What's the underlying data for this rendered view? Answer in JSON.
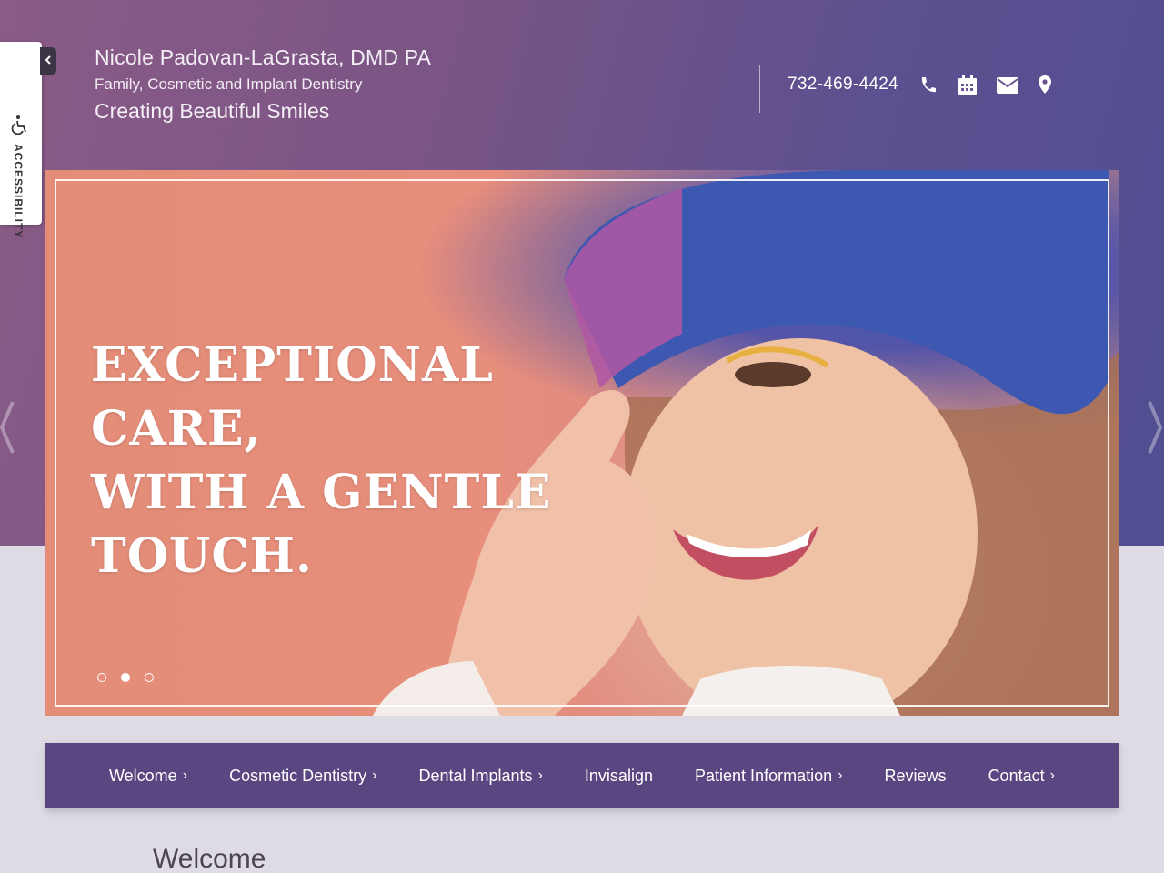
{
  "accessibility": {
    "label": "ACCESSIBILITY",
    "icon": "wheelchair-icon",
    "toggle_icon": "chevron-left-icon"
  },
  "brand": {
    "name": "Nicole Padovan-LaGrasta, DMD PA",
    "tagline": "Family, Cosmetic and Implant Dentistry",
    "slogan": "Creating Beautiful Smiles"
  },
  "contact": {
    "phone": "732-469-4424",
    "icons": [
      "phone-icon",
      "calendar-icon",
      "envelope-icon",
      "map-pin-icon"
    ]
  },
  "hero": {
    "heading_lines": [
      "EXCEPTIONAL CARE,",
      "WITH A GENTLE",
      "TOUCH."
    ],
    "slides_total": 3,
    "active_slide": 2
  },
  "nav": {
    "items": [
      {
        "label": "Welcome",
        "has_submenu": true
      },
      {
        "label": "Cosmetic Dentistry",
        "has_submenu": true
      },
      {
        "label": "Dental Implants",
        "has_submenu": true
      },
      {
        "label": "Invisalign",
        "has_submenu": false
      },
      {
        "label": "Patient Information",
        "has_submenu": true
      },
      {
        "label": "Reviews",
        "has_submenu": false
      },
      {
        "label": "Contact",
        "has_submenu": true
      }
    ]
  },
  "content": {
    "heading": "Welcome"
  },
  "colors": {
    "nav_bg": "#5a4781",
    "header_start": "#8a5b86",
    "header_end": "#514e92"
  }
}
